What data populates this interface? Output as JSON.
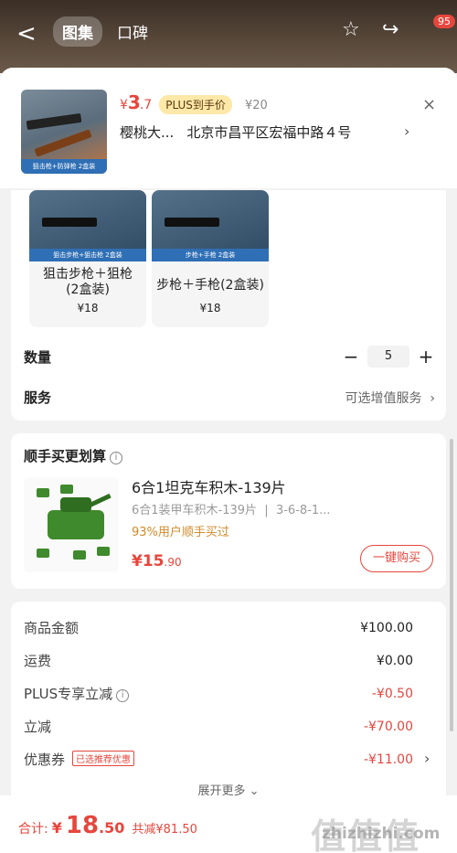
{
  "header": {
    "back": "<",
    "tabs": [
      "图集",
      "口碑"
    ],
    "badge": "95"
  },
  "product": {
    "thumb_caption": "狙击枪+防弹枪 2盒装",
    "price_currency": "¥",
    "price_int": "3",
    "price_dec": ".7",
    "plus_tag": "PLUS到手价",
    "orig_price": "¥20",
    "recipient": "樱桃大...",
    "address": "北京市昌平区宏福中路４号",
    "close": "×"
  },
  "options": [
    {
      "label": "狙击步枪＋狙枪\n(2盒装)",
      "price": "¥18",
      "caption": "狙击步枪+狙击枪 2盒装"
    },
    {
      "label": "步枪＋手枪(2盒装)",
      "price": "¥18",
      "caption": "步枪+手枪 2盒装"
    }
  ],
  "quantity": {
    "label": "数量",
    "minus": "−",
    "value": "5",
    "plus": "+"
  },
  "service": {
    "label": "服务",
    "value": "可选增值服务"
  },
  "addon": {
    "title": "顺手买更划算",
    "name": "6合1坦克车积木-139片",
    "sub": "6合1装甲车积木-139片",
    "sub2": "3-6-8-1...",
    "stat": "93%用户顺手买过",
    "price_currency": "¥",
    "price_int": "15",
    "price_dec": ".90",
    "buy_button": "一键购买"
  },
  "summary": {
    "rows": [
      {
        "label": "商品金额",
        "value": "¥100.00"
      },
      {
        "label": "运费",
        "value": "¥0.00"
      },
      {
        "label": "PLUS专享立减",
        "value": "-¥0.50"
      },
      {
        "label": "立减",
        "value": "-¥70.00"
      },
      {
        "label": "优惠券",
        "tag": "已选推荐优惠",
        "value": "-¥11.00"
      }
    ],
    "expand": "展开更多"
  },
  "bottom": {
    "total_label": "合计:",
    "currency": "¥",
    "total_int": "18",
    "total_dec": ".50",
    "savings": "共减¥81.50",
    "watermark": "值值值",
    "watermark_sub": "zhizhizhi.com"
  },
  "colors": {
    "accent": "#e6463d",
    "plus_tag_bg": "#ffe8a8"
  }
}
